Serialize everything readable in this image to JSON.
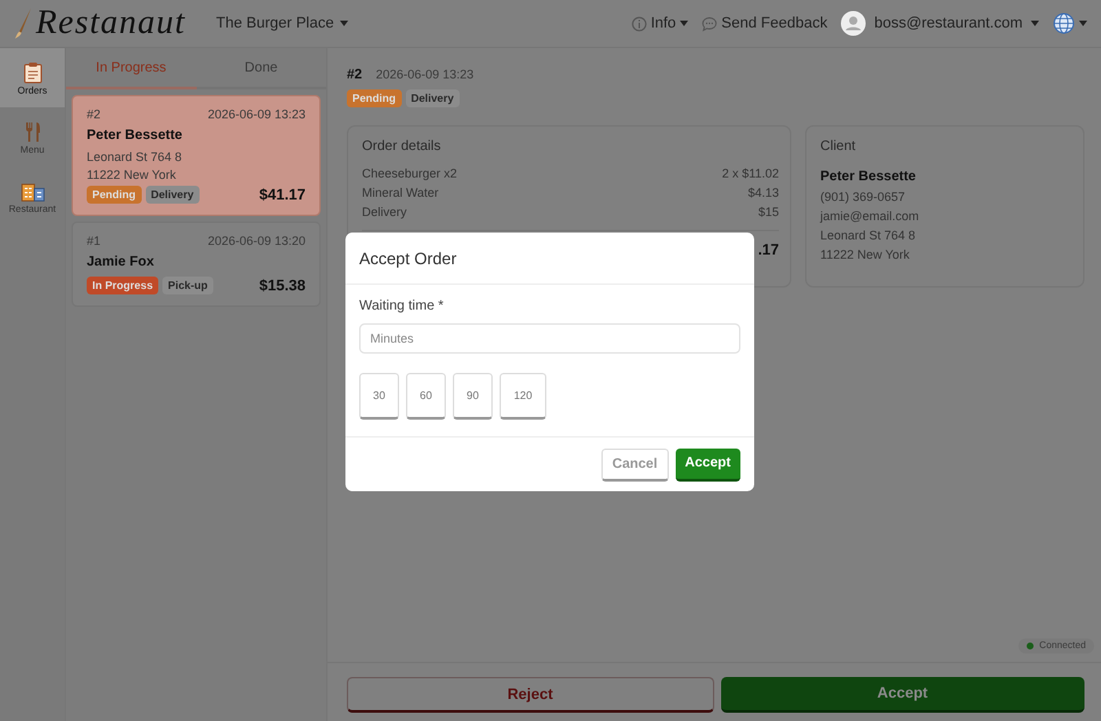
{
  "header": {
    "logo": "Restanaut",
    "restaurant": "The Burger Place",
    "menu": [
      {
        "kind": "info",
        "label": "Info",
        "dropdown": true
      },
      {
        "kind": "feedback",
        "label": "Send Feedback",
        "dropdown": false
      },
      {
        "kind": "user",
        "label": "boss@restaurant.com",
        "dropdown": true
      },
      {
        "kind": "language",
        "dropdown": true
      }
    ]
  },
  "nav": [
    {
      "kind": "orders",
      "label": "Orders",
      "selected": true
    },
    {
      "kind": "menu",
      "label": "Menu",
      "selected": false
    },
    {
      "kind": "restaurant",
      "label": "Restaurant",
      "selected": false
    }
  ],
  "tabs": [
    {
      "label": "In Progress",
      "selected": true
    },
    {
      "label": "Done",
      "selected": false
    }
  ],
  "orders": [
    {
      "number": "#2",
      "time": "2026-06-09 13:23",
      "name": "Peter Bessette",
      "address": [
        "Leonard St 764 8",
        "11222 New York"
      ],
      "badges": [
        {
          "label": "Pending",
          "kind": "status",
          "color": "#c8732e"
        },
        {
          "label": "Delivery",
          "kind": "type",
          "color": "#8c8c8c"
        }
      ],
      "total": "$41.17",
      "selected": true
    },
    {
      "number": "#1",
      "time": "2026-06-09 13:20",
      "name": "Jamie Fox",
      "badges": [
        {
          "label": "In Progress",
          "kind": "status",
          "color": "#c04a28"
        },
        {
          "label": "Pick-up",
          "kind": "type",
          "color": "#8c8c8c"
        }
      ],
      "total": "$15.38",
      "selected": false
    }
  ],
  "detail": {
    "number": "#2",
    "time": "2026-06-09 13:23",
    "badges": [
      {
        "label": "Pending",
        "kind": "status",
        "color": "#c8732e"
      },
      {
        "label": "Delivery",
        "kind": "type",
        "color": "#8c8c8c"
      }
    ],
    "order_card": {
      "title": "Order details",
      "items": [
        {
          "name": "Cheeseburger x2",
          "price": "2 x $11.02"
        },
        {
          "name": "Mineral Water",
          "price": "$4.13"
        },
        {
          "name": "Delivery",
          "price": "$15"
        }
      ],
      "total": ".17"
    },
    "client_card": {
      "title": "Client",
      "name": "Peter Bessette",
      "lines": [
        "(901) 369-0657",
        "jamie@email.com",
        "Leonard St 764 8",
        "11222 New York"
      ]
    }
  },
  "connection": {
    "label": "Connected",
    "color": "#1a5e1a"
  },
  "actions": [
    {
      "kind": "reject",
      "label": "Reject"
    },
    {
      "kind": "accept",
      "label": "Accept"
    }
  ],
  "modal": {
    "title": "Accept Order",
    "field_label": "Waiting time *",
    "placeholder": "Minutes",
    "presets": [
      "30",
      "60",
      "90",
      "120"
    ],
    "buttons": [
      {
        "kind": "cancel",
        "label": "Cancel"
      },
      {
        "kind": "accept",
        "label": "Accept"
      }
    ]
  }
}
